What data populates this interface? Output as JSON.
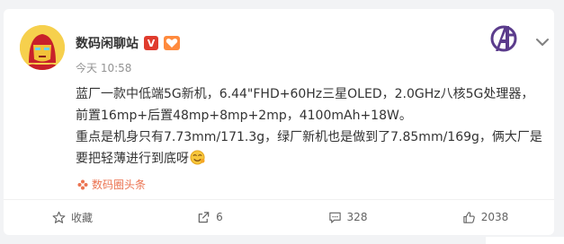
{
  "post": {
    "username": "数码闲聊站",
    "vip_badge": "V",
    "time": "今天 10:58",
    "content": {
      "line1": "蓝厂一款中低端5G新机，6.44\"FHD+60Hz三星OLED，2.0GHz八核5G处理器，",
      "line2": "前置16mp+后置48mp+8mp+2mp，4100mAh+18W。",
      "line3": "重点是机身只有7.73mm/171.3g，绿厂新机也是做到了7.85mm/169g，俩大厂是",
      "line4": "要把轻薄进行到底呀"
    },
    "source": "数码圈头条"
  },
  "actions": {
    "favorite_label": "收藏",
    "repost_count": "6",
    "comment_count": "328",
    "like_count": "2038"
  },
  "colors": {
    "accent": "#eb7350",
    "vip_red": "#e03b2d",
    "icon_gray": "#636363"
  },
  "icons": {
    "avatar": "iron-man-avatar",
    "brand": "avengers-logo-icon",
    "menu": "chevron-down-icon",
    "emoji": "smirk-emoji-icon",
    "source": "flower-icon",
    "favorite": "star-icon",
    "repost": "repost-icon",
    "comment": "comment-icon",
    "like": "thumbs-up-icon"
  }
}
